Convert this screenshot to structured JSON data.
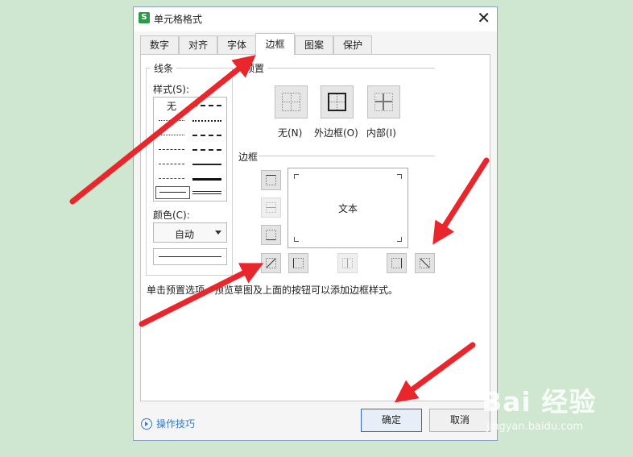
{
  "window": {
    "app_icon": "S",
    "title": "单元格格式",
    "close_glyph": "✕"
  },
  "tabs": [
    {
      "label": "数字",
      "active": false
    },
    {
      "label": "对齐",
      "active": false
    },
    {
      "label": "字体",
      "active": false
    },
    {
      "label": "边框",
      "active": true
    },
    {
      "label": "图案",
      "active": false
    },
    {
      "label": "保护",
      "active": false
    }
  ],
  "line_group": {
    "legend": "线条",
    "style_label": "样式(S):",
    "style_none": "无",
    "color_label": "颜色(C):",
    "color_value": "自动"
  },
  "preset_group": {
    "legend": "预置",
    "buttons": [
      {
        "label": "无(N)",
        "icon": "border-none-icon"
      },
      {
        "label": "外边框(O)",
        "icon": "border-outline-icon"
      },
      {
        "label": "内部(I)",
        "icon": "border-inside-icon"
      }
    ]
  },
  "border_group": {
    "legend": "边框",
    "preview_text": "文本",
    "hint": "单击预置选项、预览草图及上面的按钮可以添加边框样式。"
  },
  "footer": {
    "help_label": "操作技巧",
    "ok_label": "确定",
    "cancel_label": "取消"
  },
  "watermark": {
    "main": "Bai 经验",
    "sub": "jingyan.baidu.com"
  },
  "colors": {
    "background": "#cfe7d0",
    "arrow": "#e8262b",
    "primary_border": "#2f66c8"
  }
}
